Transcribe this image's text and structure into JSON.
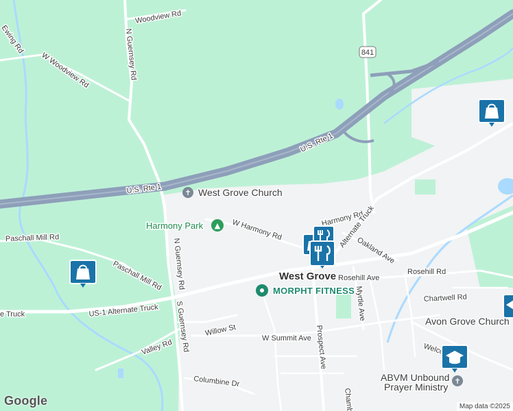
{
  "map": {
    "colors": {
      "land": "#bdf1d6",
      "urban": "#f1f3f4",
      "water": "#aadaff",
      "highway": "#8e9fb9",
      "road": "#ffffff",
      "marker": "#1a73a8"
    },
    "labels": {
      "woodview_rd": "Woodview Rd",
      "n_guernsey_rd_top": "N Guernsey Rd",
      "ewing_rd": "Ewing Rd",
      "w_woodview_rd": "W Woodview Rd",
      "us_rte1_left": "U.S. Rte 1",
      "us_rte1_right": "U.S. Rte 1",
      "route_841": "841",
      "west_grove_church": "West Grove Church",
      "harmony_park": "Harmony Park",
      "w_harmony_rd": "W Harmony Rd",
      "harmony_rd": "Harmony Rd",
      "alternate_truck": "Alternate Truck",
      "oakland_ave": "Oakland Ave",
      "paschall_mill_rd_left": "Paschall Mill Rd",
      "paschall_mill_rd_right": "Paschall Mill Rd",
      "n_guernsey_rd": "N Guernsey Rd",
      "s_guernsey_rd": "S Guernsey Rd",
      "west_grove": "West Grove",
      "rosehill_ave": "Rosehill Ave",
      "rosehill_rd": "Rosehill Rd",
      "morpht_fitness": "MORPHT FITNESS",
      "myrtle_ave": "Myrtle Ave",
      "chartwell_rd": "Chartwell Rd",
      "avon_grove_church": "Avon Grove Church",
      "us1_alt_truck": "US-1 Alternate Truck",
      "e_truck": "e Truck",
      "welcome_ave": "Welcome Ave",
      "willow_st": "Willow St",
      "w_summit_ave": "W Summit Ave",
      "valley_rd": "Valley Rd",
      "prospect_ave": "Prospect Ave",
      "abvm_line1": "ABVM Unbound",
      "abvm_line2": "Prayer Ministry",
      "columbine_dr": "Columbine Dr",
      "chamb": "Chamb"
    },
    "markers": [
      "shopping-bag",
      "shopping-bag",
      "restaurant",
      "restaurant",
      "shopping-bag",
      "school",
      "school"
    ],
    "logo": "Google",
    "attribution": "Map data ©2025"
  }
}
